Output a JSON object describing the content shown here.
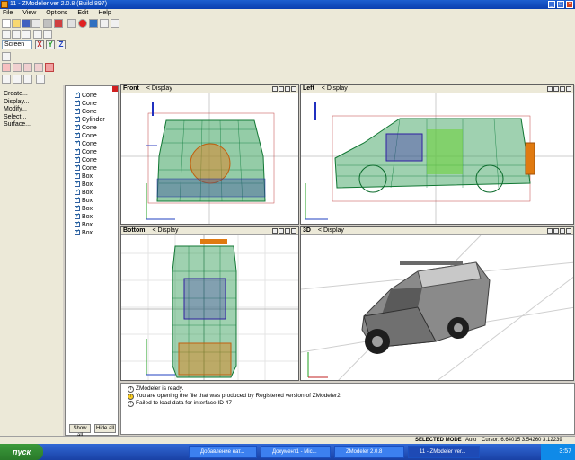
{
  "window": {
    "title": "11 - ZModeler ver 2.0.8 (Build 897)"
  },
  "menu": [
    "File",
    "View",
    "Options",
    "Edit",
    "Help"
  ],
  "toolbar": {
    "coord_mode": "Screen",
    "axes": [
      "X",
      "Y",
      "Z"
    ]
  },
  "commands": [
    "Create...",
    "Display...",
    "Modify...",
    "Select...",
    "Surface..."
  ],
  "objects": [
    "Cone",
    "Cone",
    "Cone",
    "Cylinder",
    "Cone",
    "Cone",
    "Cone",
    "Cone",
    "Cone",
    "Cone",
    "Box",
    "Box",
    "Box",
    "Box",
    "Box",
    "Box",
    "Box",
    "Box"
  ],
  "object_buttons": {
    "show_all": "Show all",
    "hide_all": "Hide all"
  },
  "viewports": [
    {
      "name": "Front",
      "display": "< Display"
    },
    {
      "name": "Left",
      "display": "< Display"
    },
    {
      "name": "Bottom",
      "display": "< Display"
    },
    {
      "name": "3D",
      "display": "< Display"
    }
  ],
  "log": [
    "ZModeler is ready.",
    "You are opening the file that was produced by Registered version of ZModeler2.",
    "Failed to load data for interface ID 47"
  ],
  "status": {
    "mode": "SELECTED MODE",
    "auto": "Auto",
    "cursor": "Cursor: 6.64015  3.54260  3.12239"
  },
  "taskbar": {
    "start": "пуск",
    "tasks": [
      "Добавление нат...",
      "Документ1 - Mic...",
      "ZModeler 2.0.8",
      "11 - ZModeler ver..."
    ],
    "clock": "3:57"
  },
  "colors": {
    "wire_green": "#1aa04a",
    "wire_orange": "#e07a10",
    "wire_blue": "#2030c0"
  }
}
